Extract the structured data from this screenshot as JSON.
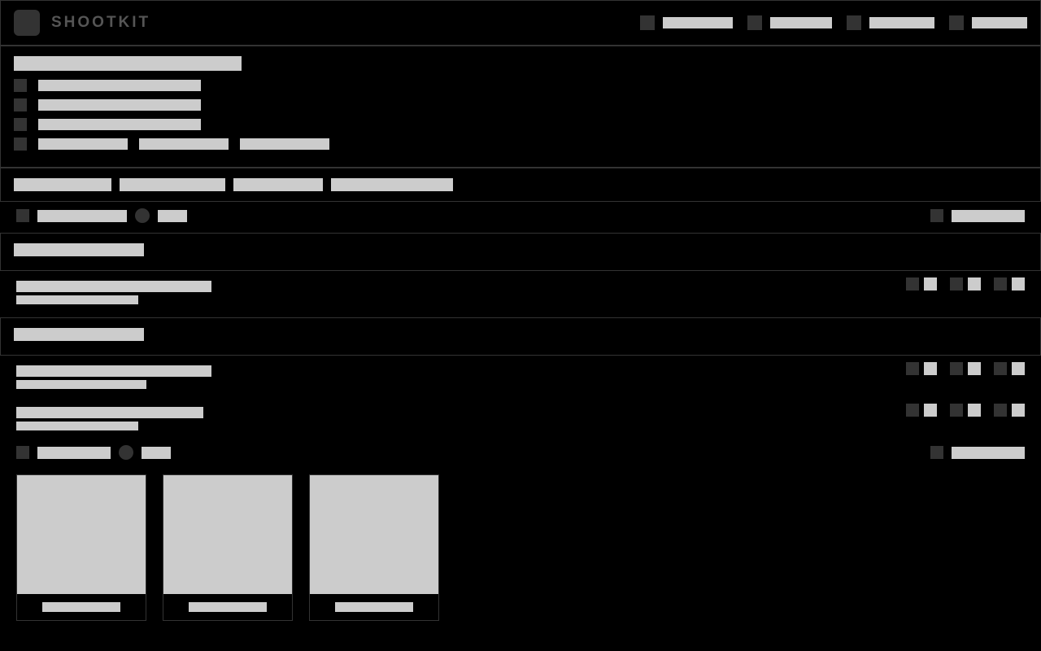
{
  "header": {
    "brand": "SHOOTKIT",
    "nav": [
      "",
      "",
      "",
      ""
    ]
  },
  "intro": {
    "title": "",
    "lines": [
      "",
      "",
      ""
    ],
    "last_line_parts": [
      "",
      "",
      ""
    ]
  },
  "tags": [
    "",
    "",
    "",
    ""
  ],
  "breadcrumb": {
    "crumb1": "",
    "crumb2": "",
    "right": ""
  },
  "section1": {
    "heading": "",
    "title": "",
    "subtitle": ""
  },
  "section2": {
    "heading": "",
    "items": [
      {
        "title": "",
        "subtitle": ""
      },
      {
        "title": "",
        "subtitle": ""
      }
    ],
    "footer_crumb1": "",
    "footer_crumb2": "",
    "footer_right": ""
  },
  "cards": [
    "",
    "",
    ""
  ]
}
